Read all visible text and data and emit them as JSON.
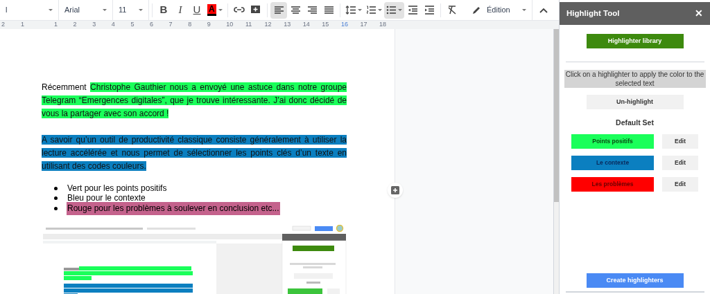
{
  "toolbar": {
    "style_dropdown": "l",
    "font": "Arial",
    "size": "11",
    "buttons": [
      {
        "kind": "bold",
        "label": "B",
        "selected": false
      },
      {
        "kind": "italic",
        "label": "I",
        "selected": false
      },
      {
        "kind": "underline",
        "label": "U",
        "selected": false
      },
      {
        "kind": "text-color",
        "label": "A",
        "color": "#ff0000",
        "selected": false
      },
      {
        "kind": "link",
        "selected": false
      },
      {
        "kind": "comment",
        "selected": false
      },
      {
        "kind": "align-left",
        "selected": true
      },
      {
        "kind": "align-center",
        "selected": false
      },
      {
        "kind": "align-right",
        "selected": false
      },
      {
        "kind": "justify",
        "selected": false
      },
      {
        "kind": "line-spacing",
        "selected": false
      },
      {
        "kind": "numbered-list",
        "selected": false
      },
      {
        "kind": "bulleted-list",
        "selected": true
      },
      {
        "kind": "indent-less",
        "selected": false
      },
      {
        "kind": "indent-more",
        "selected": false
      },
      {
        "kind": "clear-format",
        "selected": false
      }
    ],
    "mode": "Édition"
  },
  "ruler": {
    "labels": [
      "2",
      "1",
      "1",
      "2",
      "3",
      "4",
      "5",
      "6",
      "7",
      "8",
      "9",
      "10",
      "11",
      "12",
      "13",
      "14",
      "15",
      "16",
      "17",
      "18"
    ]
  },
  "document": {
    "paragraphs": [
      [
        {
          "text": "Récemment "
        },
        {
          "text": "Christophe Gauthier nous a envoyé une astuce dans notre groupe Telegram “Emergences digitales”,  que je trouve intéressante. J’ai donc décidé de vous la partager avec son accord !",
          "color": "#1aff5a"
        }
      ],
      [
        {
          "text": "A savoir qu’un outil de productivité classique consiste généralement à utiliser la lecture accélérée et nous permet de sélectionner les points clés d’un texte en utilisant des codes couleurs.",
          "color": "#0b7fc0"
        }
      ]
    ],
    "list": [
      {
        "text": "Vert pour les points positifs"
      },
      {
        "text": "Bleu pour le contexte"
      },
      {
        "text": "Rouge pour les problèmes à soulever en conclusion etc...",
        "color": "#c4628c"
      }
    ]
  },
  "sidebar": {
    "title": "Highlight Tool",
    "close": "✕",
    "library_button": "Highlighter library",
    "instruction": "Click on a highlighter to apply the color to the selected text",
    "unhighlight_button": "Un-highlight",
    "set_title": "Default Set",
    "highlighters": [
      {
        "label": "Points positifs",
        "color": "#1aff5a",
        "edit": "Edit"
      },
      {
        "label": "Le contexte",
        "color": "#0b7fc0",
        "edit": "Edit"
      },
      {
        "label": "Les problèmes",
        "color": "#ff0000",
        "edit": "Edit"
      }
    ],
    "create_button": "Create highlighters"
  }
}
